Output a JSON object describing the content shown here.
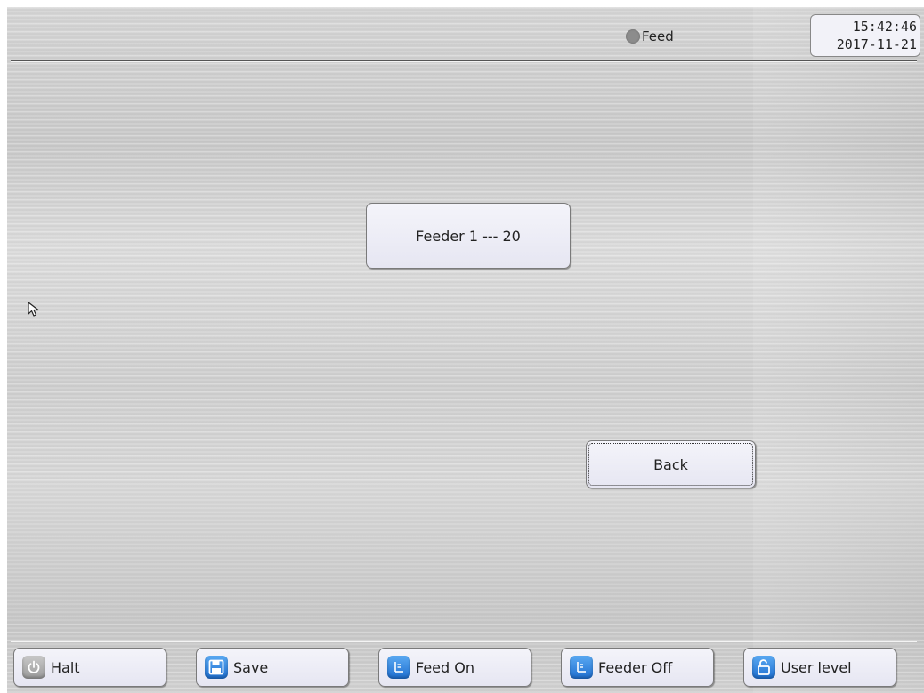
{
  "header": {
    "status_label": "Feed",
    "status_color": "#8c8c8c",
    "time": "15:42:46",
    "date": "2017-11-21"
  },
  "main": {
    "feeder_button_label": "Feeder 1 --- 20",
    "back_button_label": "Back"
  },
  "toolbar": {
    "halt_label": "Halt",
    "save_label": "Save",
    "feed_on_label": "Feed On",
    "feeder_off_label": "Feeder Off",
    "user_level_label": "User level"
  },
  "icons": {
    "halt": "power-icon",
    "save": "floppy-disk-icon",
    "feed_on": "feed-icon",
    "feeder_off": "feed-icon",
    "user_level": "unlock-icon",
    "cursor": "mouse-pointer-icon"
  },
  "colors": {
    "accent_blue": "#1f6fd0",
    "button_face": "#e6e6f2"
  }
}
